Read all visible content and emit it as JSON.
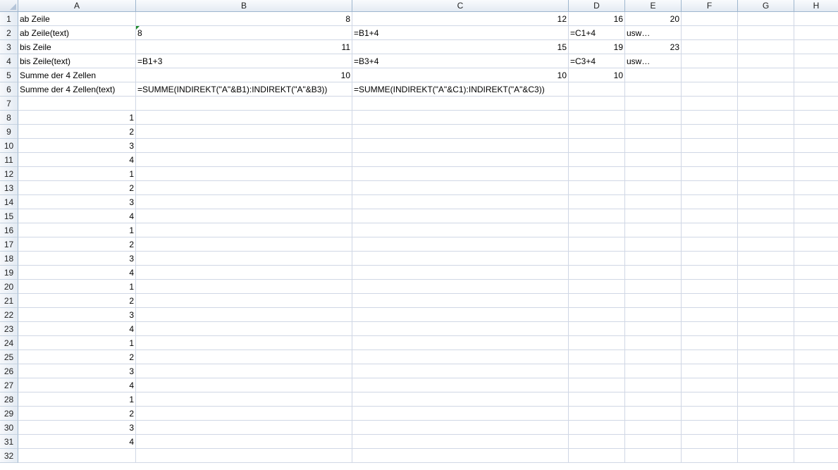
{
  "columns": [
    "A",
    "B",
    "C",
    "D",
    "E",
    "F",
    "G",
    "H"
  ],
  "rows": [
    {
      "n": "1",
      "cells": [
        {
          "v": "ab Zeile",
          "a": "txt"
        },
        {
          "v": "8",
          "a": "num"
        },
        {
          "v": "12",
          "a": "num"
        },
        {
          "v": "16",
          "a": "num"
        },
        {
          "v": "20",
          "a": "num"
        },
        {
          "v": ""
        },
        {
          "v": ""
        },
        {
          "v": ""
        }
      ]
    },
    {
      "n": "2",
      "cells": [
        {
          "v": "ab Zeile(text)",
          "a": "txt"
        },
        {
          "v": "8",
          "a": "txt",
          "flag": true
        },
        {
          "v": "=B1+4",
          "a": "txt"
        },
        {
          "v": "=C1+4",
          "a": "txt"
        },
        {
          "v": "usw…",
          "a": "txt"
        },
        {
          "v": ""
        },
        {
          "v": ""
        },
        {
          "v": ""
        }
      ]
    },
    {
      "n": "3",
      "cells": [
        {
          "v": "bis Zeile",
          "a": "txt"
        },
        {
          "v": "11",
          "a": "num"
        },
        {
          "v": "15",
          "a": "num"
        },
        {
          "v": "19",
          "a": "num"
        },
        {
          "v": "23",
          "a": "num"
        },
        {
          "v": ""
        },
        {
          "v": ""
        },
        {
          "v": ""
        }
      ]
    },
    {
      "n": "4",
      "cells": [
        {
          "v": "bis Zeile(text)",
          "a": "txt"
        },
        {
          "v": "=B1+3",
          "a": "txt"
        },
        {
          "v": "=B3+4",
          "a": "txt"
        },
        {
          "v": "=C3+4",
          "a": "txt"
        },
        {
          "v": "usw…",
          "a": "txt"
        },
        {
          "v": ""
        },
        {
          "v": ""
        },
        {
          "v": ""
        }
      ]
    },
    {
      "n": "5",
      "cells": [
        {
          "v": "Summe der 4 Zellen",
          "a": "txt"
        },
        {
          "v": "10",
          "a": "num"
        },
        {
          "v": "10",
          "a": "num"
        },
        {
          "v": "10",
          "a": "num"
        },
        {
          "v": ""
        },
        {
          "v": ""
        },
        {
          "v": ""
        },
        {
          "v": ""
        }
      ]
    },
    {
      "n": "6",
      "cells": [
        {
          "v": "Summe der 4 Zellen(text)",
          "a": "txt"
        },
        {
          "v": "=SUMME(INDIREKT(\"A\"&B1):INDIREKT(\"A\"&B3))",
          "a": "txt"
        },
        {
          "v": "=SUMME(INDIREKT(\"A\"&C1):INDIREKT(\"A\"&C3))",
          "a": "txt"
        },
        {
          "v": ""
        },
        {
          "v": ""
        },
        {
          "v": ""
        },
        {
          "v": ""
        },
        {
          "v": ""
        }
      ]
    },
    {
      "n": "7",
      "cells": [
        {
          "v": ""
        },
        {
          "v": ""
        },
        {
          "v": ""
        },
        {
          "v": ""
        },
        {
          "v": ""
        },
        {
          "v": ""
        },
        {
          "v": ""
        },
        {
          "v": ""
        }
      ]
    },
    {
      "n": "8",
      "cells": [
        {
          "v": "1",
          "a": "num"
        },
        {
          "v": ""
        },
        {
          "v": ""
        },
        {
          "v": ""
        },
        {
          "v": ""
        },
        {
          "v": ""
        },
        {
          "v": ""
        },
        {
          "v": ""
        }
      ]
    },
    {
      "n": "9",
      "cells": [
        {
          "v": "2",
          "a": "num"
        },
        {
          "v": ""
        },
        {
          "v": ""
        },
        {
          "v": ""
        },
        {
          "v": ""
        },
        {
          "v": ""
        },
        {
          "v": ""
        },
        {
          "v": ""
        }
      ]
    },
    {
      "n": "10",
      "cells": [
        {
          "v": "3",
          "a": "num"
        },
        {
          "v": ""
        },
        {
          "v": ""
        },
        {
          "v": ""
        },
        {
          "v": ""
        },
        {
          "v": ""
        },
        {
          "v": ""
        },
        {
          "v": ""
        }
      ]
    },
    {
      "n": "11",
      "cells": [
        {
          "v": "4",
          "a": "num"
        },
        {
          "v": ""
        },
        {
          "v": ""
        },
        {
          "v": ""
        },
        {
          "v": ""
        },
        {
          "v": ""
        },
        {
          "v": ""
        },
        {
          "v": ""
        }
      ]
    },
    {
      "n": "12",
      "cells": [
        {
          "v": "1",
          "a": "num"
        },
        {
          "v": ""
        },
        {
          "v": ""
        },
        {
          "v": ""
        },
        {
          "v": ""
        },
        {
          "v": ""
        },
        {
          "v": ""
        },
        {
          "v": ""
        }
      ]
    },
    {
      "n": "13",
      "cells": [
        {
          "v": "2",
          "a": "num"
        },
        {
          "v": ""
        },
        {
          "v": ""
        },
        {
          "v": ""
        },
        {
          "v": ""
        },
        {
          "v": ""
        },
        {
          "v": ""
        },
        {
          "v": ""
        }
      ]
    },
    {
      "n": "14",
      "cells": [
        {
          "v": "3",
          "a": "num"
        },
        {
          "v": ""
        },
        {
          "v": ""
        },
        {
          "v": ""
        },
        {
          "v": ""
        },
        {
          "v": ""
        },
        {
          "v": ""
        },
        {
          "v": ""
        }
      ]
    },
    {
      "n": "15",
      "cells": [
        {
          "v": "4",
          "a": "num"
        },
        {
          "v": ""
        },
        {
          "v": ""
        },
        {
          "v": ""
        },
        {
          "v": ""
        },
        {
          "v": ""
        },
        {
          "v": ""
        },
        {
          "v": ""
        }
      ]
    },
    {
      "n": "16",
      "cells": [
        {
          "v": "1",
          "a": "num"
        },
        {
          "v": ""
        },
        {
          "v": ""
        },
        {
          "v": ""
        },
        {
          "v": ""
        },
        {
          "v": ""
        },
        {
          "v": ""
        },
        {
          "v": ""
        }
      ]
    },
    {
      "n": "17",
      "cells": [
        {
          "v": "2",
          "a": "num"
        },
        {
          "v": ""
        },
        {
          "v": ""
        },
        {
          "v": ""
        },
        {
          "v": ""
        },
        {
          "v": ""
        },
        {
          "v": ""
        },
        {
          "v": ""
        }
      ]
    },
    {
      "n": "18",
      "cells": [
        {
          "v": "3",
          "a": "num"
        },
        {
          "v": ""
        },
        {
          "v": ""
        },
        {
          "v": ""
        },
        {
          "v": ""
        },
        {
          "v": ""
        },
        {
          "v": ""
        },
        {
          "v": ""
        }
      ]
    },
    {
      "n": "19",
      "cells": [
        {
          "v": "4",
          "a": "num"
        },
        {
          "v": ""
        },
        {
          "v": ""
        },
        {
          "v": ""
        },
        {
          "v": ""
        },
        {
          "v": ""
        },
        {
          "v": ""
        },
        {
          "v": ""
        }
      ]
    },
    {
      "n": "20",
      "cells": [
        {
          "v": "1",
          "a": "num"
        },
        {
          "v": ""
        },
        {
          "v": ""
        },
        {
          "v": ""
        },
        {
          "v": ""
        },
        {
          "v": ""
        },
        {
          "v": ""
        },
        {
          "v": ""
        }
      ]
    },
    {
      "n": "21",
      "cells": [
        {
          "v": "2",
          "a": "num"
        },
        {
          "v": ""
        },
        {
          "v": ""
        },
        {
          "v": ""
        },
        {
          "v": ""
        },
        {
          "v": ""
        },
        {
          "v": ""
        },
        {
          "v": ""
        }
      ]
    },
    {
      "n": "22",
      "cells": [
        {
          "v": "3",
          "a": "num"
        },
        {
          "v": ""
        },
        {
          "v": ""
        },
        {
          "v": ""
        },
        {
          "v": ""
        },
        {
          "v": ""
        },
        {
          "v": ""
        },
        {
          "v": ""
        }
      ]
    },
    {
      "n": "23",
      "cells": [
        {
          "v": "4",
          "a": "num"
        },
        {
          "v": ""
        },
        {
          "v": ""
        },
        {
          "v": ""
        },
        {
          "v": ""
        },
        {
          "v": ""
        },
        {
          "v": ""
        },
        {
          "v": ""
        }
      ]
    },
    {
      "n": "24",
      "cells": [
        {
          "v": "1",
          "a": "num"
        },
        {
          "v": ""
        },
        {
          "v": ""
        },
        {
          "v": ""
        },
        {
          "v": ""
        },
        {
          "v": ""
        },
        {
          "v": ""
        },
        {
          "v": ""
        }
      ]
    },
    {
      "n": "25",
      "cells": [
        {
          "v": "2",
          "a": "num"
        },
        {
          "v": ""
        },
        {
          "v": ""
        },
        {
          "v": ""
        },
        {
          "v": ""
        },
        {
          "v": ""
        },
        {
          "v": ""
        },
        {
          "v": ""
        }
      ]
    },
    {
      "n": "26",
      "cells": [
        {
          "v": "3",
          "a": "num"
        },
        {
          "v": ""
        },
        {
          "v": ""
        },
        {
          "v": ""
        },
        {
          "v": ""
        },
        {
          "v": ""
        },
        {
          "v": ""
        },
        {
          "v": ""
        }
      ]
    },
    {
      "n": "27",
      "cells": [
        {
          "v": "4",
          "a": "num"
        },
        {
          "v": ""
        },
        {
          "v": ""
        },
        {
          "v": ""
        },
        {
          "v": ""
        },
        {
          "v": ""
        },
        {
          "v": ""
        },
        {
          "v": ""
        }
      ]
    },
    {
      "n": "28",
      "cells": [
        {
          "v": "1",
          "a": "num"
        },
        {
          "v": ""
        },
        {
          "v": ""
        },
        {
          "v": ""
        },
        {
          "v": ""
        },
        {
          "v": ""
        },
        {
          "v": ""
        },
        {
          "v": ""
        }
      ]
    },
    {
      "n": "29",
      "cells": [
        {
          "v": "2",
          "a": "num"
        },
        {
          "v": ""
        },
        {
          "v": ""
        },
        {
          "v": ""
        },
        {
          "v": ""
        },
        {
          "v": ""
        },
        {
          "v": ""
        },
        {
          "v": ""
        }
      ]
    },
    {
      "n": "30",
      "cells": [
        {
          "v": "3",
          "a": "num"
        },
        {
          "v": ""
        },
        {
          "v": ""
        },
        {
          "v": ""
        },
        {
          "v": ""
        },
        {
          "v": ""
        },
        {
          "v": ""
        },
        {
          "v": ""
        }
      ]
    },
    {
      "n": "31",
      "cells": [
        {
          "v": "4",
          "a": "num"
        },
        {
          "v": ""
        },
        {
          "v": ""
        },
        {
          "v": ""
        },
        {
          "v": ""
        },
        {
          "v": ""
        },
        {
          "v": ""
        },
        {
          "v": ""
        }
      ]
    },
    {
      "n": "32",
      "cells": [
        {
          "v": ""
        },
        {
          "v": ""
        },
        {
          "v": ""
        },
        {
          "v": ""
        },
        {
          "v": ""
        },
        {
          "v": ""
        },
        {
          "v": ""
        },
        {
          "v": ""
        }
      ]
    }
  ],
  "colors": {
    "gridline": "#d0d7e5",
    "header_border": "#9eb6ce",
    "error_indicator": "#1f8a2a"
  }
}
